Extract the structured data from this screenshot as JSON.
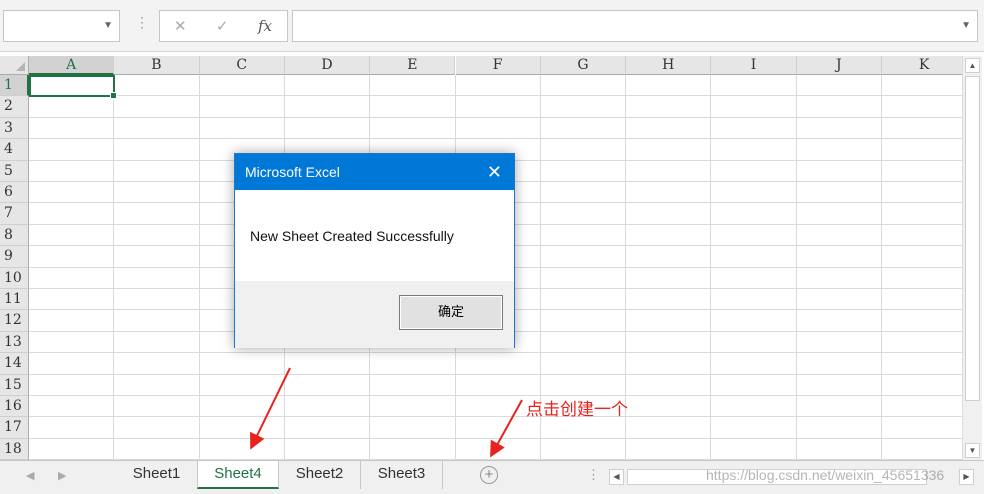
{
  "formula_bar": {
    "name_box": "",
    "cancel_icon": "✕",
    "enter_icon": "✓",
    "fx_icon": "fx",
    "formula": ""
  },
  "columns": [
    "A",
    "B",
    "C",
    "D",
    "E",
    "F",
    "G",
    "H",
    "I",
    "J",
    "K"
  ],
  "rows": [
    "1",
    "2",
    "3",
    "4",
    "5",
    "6",
    "7",
    "8",
    "9",
    "10",
    "11",
    "12",
    "13",
    "14",
    "15",
    "16",
    "17",
    "18"
  ],
  "active_cell": "A1",
  "sheet_tabs": [
    {
      "label": "Sheet1",
      "active": false
    },
    {
      "label": "Sheet4",
      "active": true
    },
    {
      "label": "Sheet2",
      "active": false
    },
    {
      "label": "Sheet3",
      "active": false
    }
  ],
  "dialog": {
    "title": "Microsoft Excel",
    "message": "New Sheet Created Successfully",
    "ok_label": "确定"
  },
  "annotation": "点击创建一个",
  "watermark": "https://blog.csdn.net/weixin_45651336",
  "colors": {
    "excel_green": "#217346",
    "dialog_blue": "#0078d7",
    "annotation_red": "#e8231d"
  }
}
